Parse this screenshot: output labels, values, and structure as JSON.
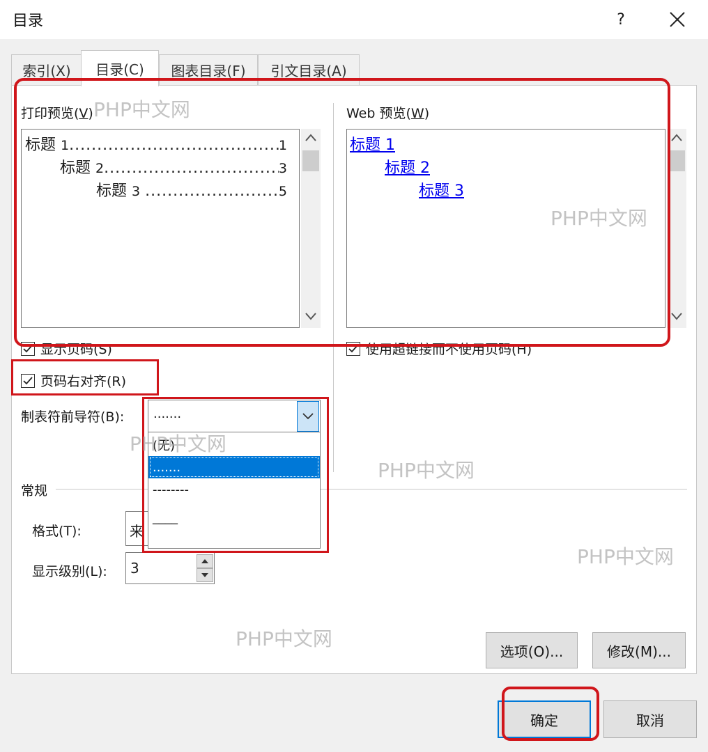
{
  "window": {
    "title": "目录",
    "help_label": "?"
  },
  "tabs": [
    {
      "label": "索引(X)"
    },
    {
      "label": "目录(C)"
    },
    {
      "label": "图表目录(F)"
    },
    {
      "label": "引文目录(A)"
    }
  ],
  "print_preview": {
    "label_text": "打印预览(",
    "label_key": "V",
    "label_end": ")",
    "lines": [
      {
        "text": "标题",
        "num": "1",
        "dots": "......................................",
        "page": "1"
      },
      {
        "text": "标题",
        "num": "2",
        "dots": "......................................",
        "page": "3"
      },
      {
        "text": "标题",
        "num": "3",
        "dots": "......................................",
        "page": "5"
      }
    ]
  },
  "web_preview": {
    "label_text": "Web 预览(",
    "label_key": "W",
    "label_end": ")",
    "links": [
      "标题 1",
      "标题 2",
      "标题 3"
    ]
  },
  "options": {
    "show_page_numbers": "显示页码(S)",
    "right_align": "页码右对齐(R)",
    "use_hyperlinks": "使用超链接而不使用页码(H)",
    "tab_leader_label": "制表符前导符(B):",
    "tab_leader_value": ".......",
    "tab_leader_options": [
      "(无)",
      ".......",
      "--------",
      "____"
    ]
  },
  "general": {
    "section_label": "常规",
    "format_label": "格式(T):",
    "format_value": "来",
    "levels_label": "显示级别(L):",
    "levels_value": "3"
  },
  "buttons": {
    "options": "选项(O)...",
    "modify": "修改(M)...",
    "ok": "确定",
    "cancel": "取消"
  },
  "watermark": "PHP中文网",
  "colors": {
    "accent": "#0078d7",
    "annotation_red": "#d0161b",
    "link": "#0000ee"
  }
}
